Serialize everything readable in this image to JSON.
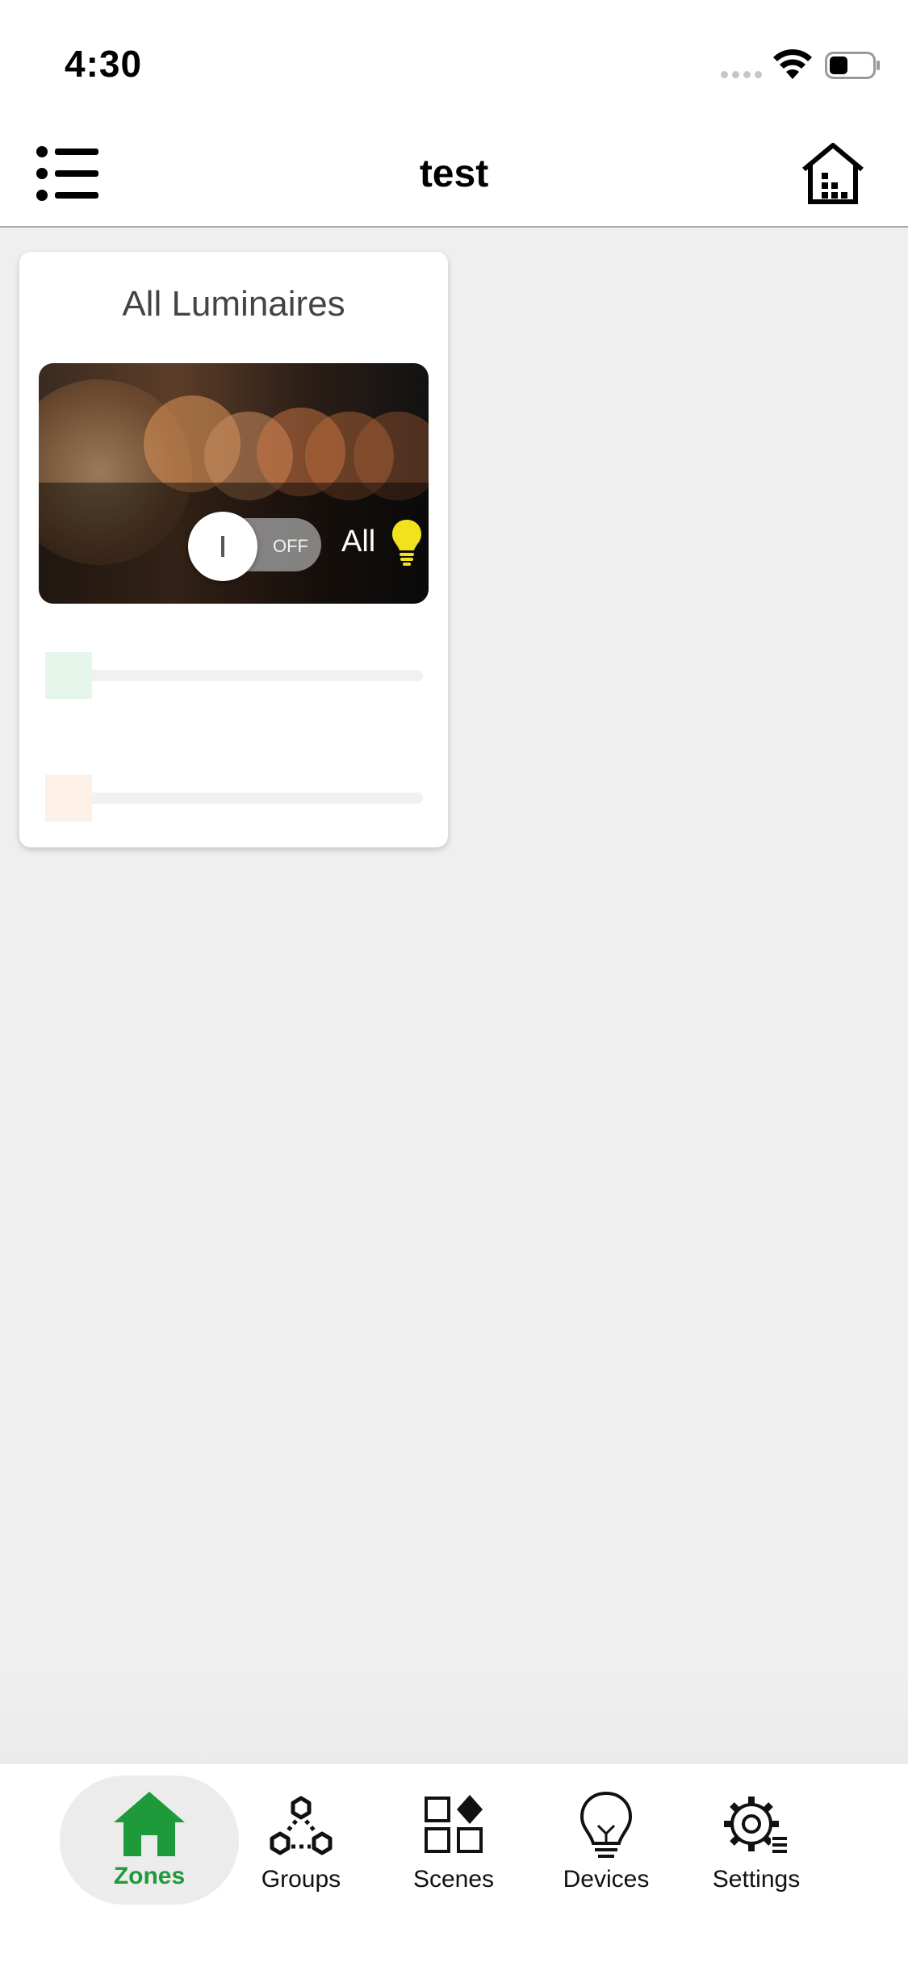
{
  "status_bar": {
    "time": "4:30"
  },
  "header": {
    "title": "test"
  },
  "zone_card": {
    "title": "All Luminaires",
    "toggle": {
      "state_label": "OFF",
      "is_on": false
    },
    "group_label": "All",
    "sliders": [
      {
        "name": "brightness",
        "thumb_color": "#e6f6ea",
        "value": 0
      },
      {
        "name": "color-temperature",
        "thumb_color": "#fdf0e6",
        "value": 0
      }
    ]
  },
  "tab_bar": {
    "active_color": "#1f9a3a",
    "tabs": [
      {
        "label": "Zones",
        "icon": "house-icon",
        "active": true
      },
      {
        "label": "Groups",
        "icon": "groups-icon",
        "active": false
      },
      {
        "label": "Scenes",
        "icon": "scenes-icon",
        "active": false
      },
      {
        "label": "Devices",
        "icon": "lightbulb-outline-icon",
        "active": false
      },
      {
        "label": "Settings",
        "icon": "gear-icon",
        "active": false
      }
    ]
  }
}
